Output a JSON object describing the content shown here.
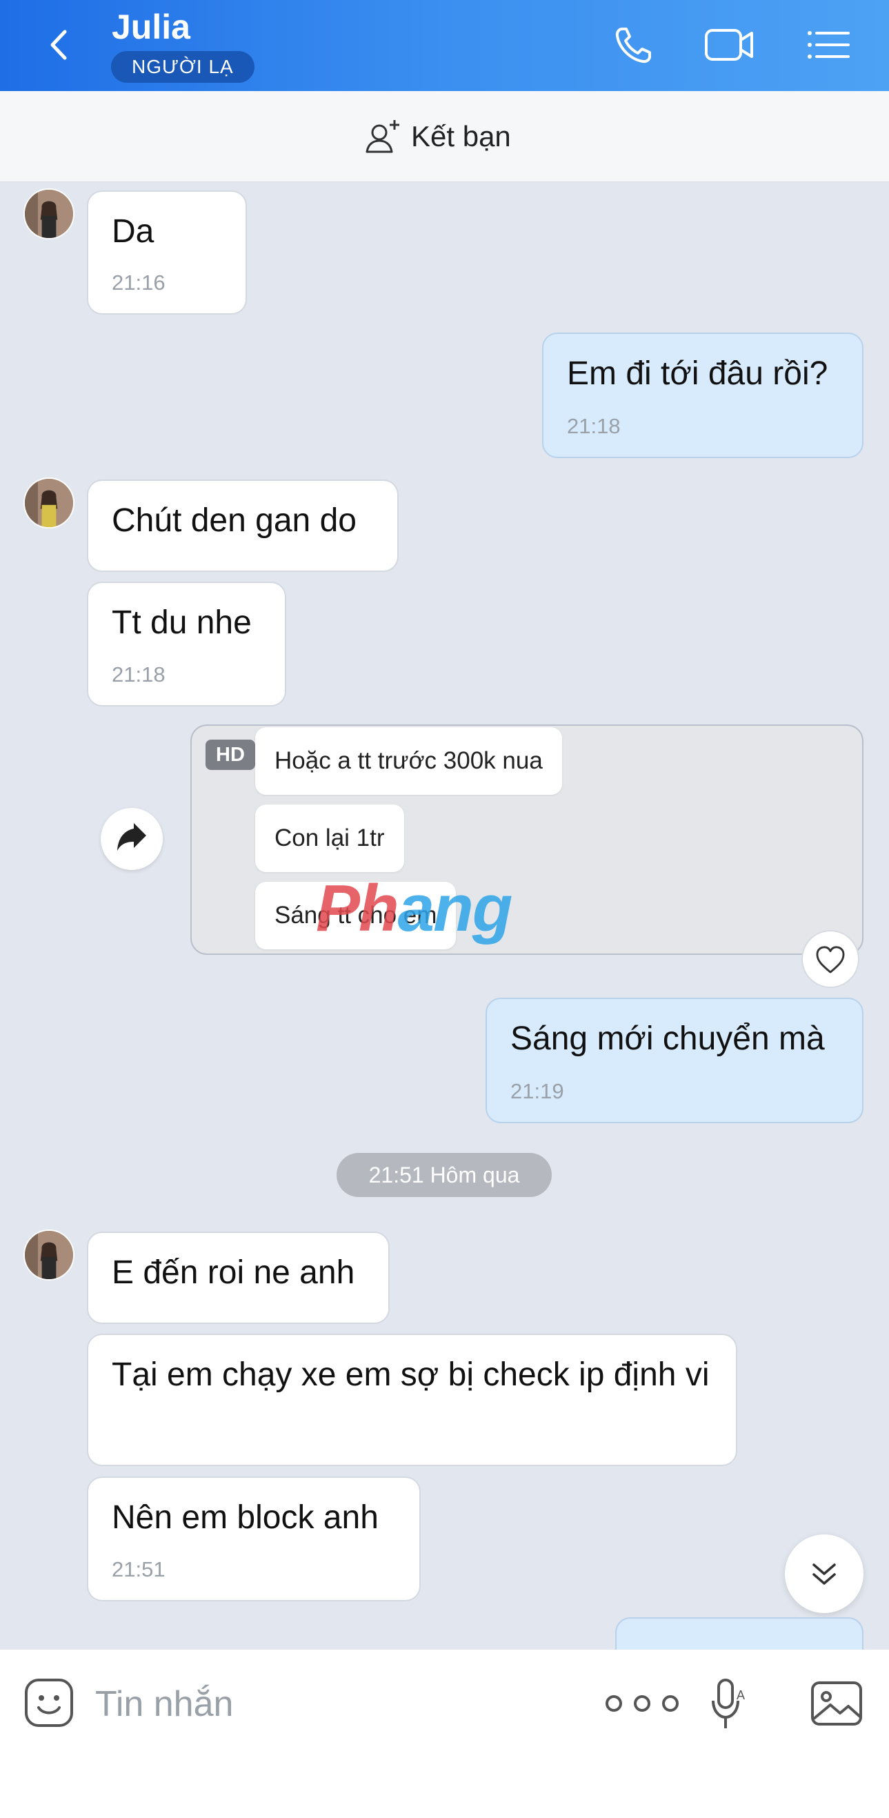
{
  "header": {
    "title": "Julia",
    "badge": "NGƯỜI LẠ",
    "icons": [
      "chevron-left-icon",
      "phone-icon",
      "video-call-icon",
      "menu-list-icon"
    ],
    "color": "#2f85ee"
  },
  "friend_bar": {
    "label": "Kết bạn",
    "icon": "add-friend-icon"
  },
  "messages": [
    {
      "sender": "other",
      "text": "Da",
      "time": "21:16"
    },
    {
      "sender": "me",
      "text": "Em đi tới đâu rồi?",
      "time": "21:18"
    },
    {
      "sender": "other",
      "text": "Chút den gan do",
      "time": ""
    },
    {
      "sender": "other",
      "text": "Tt du nhe",
      "time": "21:18"
    },
    {
      "sender": "me",
      "text": "Sáng mới chuyển mà",
      "time": "21:19"
    },
    {
      "sender": "other",
      "text": "E đến roi ne anh",
      "time": ""
    },
    {
      "sender": "other",
      "text": "Tại em chạy xe em sợ bị check ip định vi",
      "time": ""
    },
    {
      "sender": "other",
      "text": "Nên em block anh",
      "time": "21:51"
    }
  ],
  "image_message": {
    "hd_label": "HD",
    "lines": [
      "Hoặc a tt trước 300k nua",
      "Con lại 1tr",
      "Sáng tt cho em"
    ],
    "watermark_part1": "Ph",
    "watermark_part2": "ang"
  },
  "date_separator": "21:51 Hôm qua",
  "input": {
    "placeholder": "Tin nhắn",
    "value": "",
    "icons": [
      "sticker-icon",
      "more-icon",
      "voice-mic-icon",
      "image-icon"
    ]
  },
  "colors": {
    "background": "#e2e6ee",
    "my_bubble": "#d7ebfd",
    "other_bubble": "#ffffff"
  }
}
